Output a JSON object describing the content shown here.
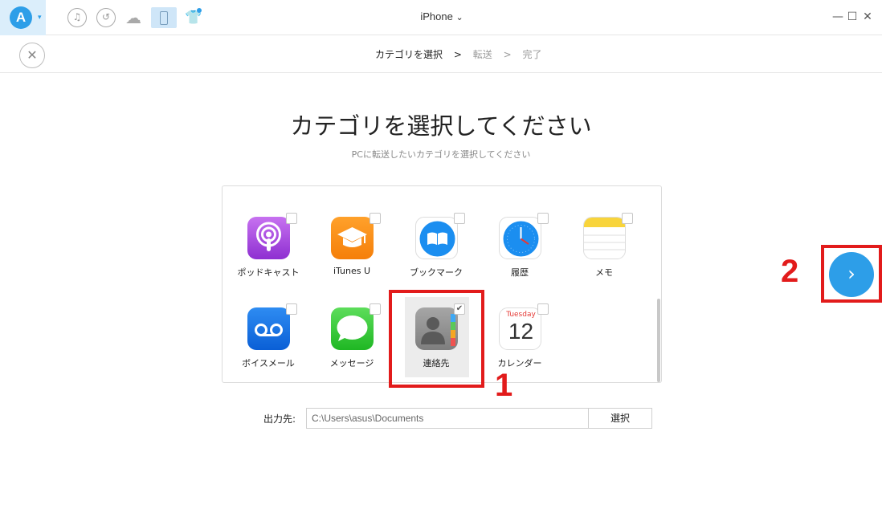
{
  "topbar": {
    "device_name": "iPhone",
    "device_caret": "⌄",
    "minimize": "—",
    "maximize": "☐",
    "close": "✕"
  },
  "stepbar": {
    "steps": [
      "カテゴリを選択",
      ">",
      "転送",
      ">",
      "完了"
    ]
  },
  "heading": {
    "title": "カテゴリを選択してください",
    "subtitle": "PCに転送したいカテゴリを選択してください"
  },
  "categories": [
    {
      "label": "ポッドキャスト",
      "checked": false,
      "icon": "podcast-icon"
    },
    {
      "label": "iTunes U",
      "checked": false,
      "icon": "itunes-u-icon"
    },
    {
      "label": "ブックマーク",
      "checked": false,
      "icon": "bookmark-icon"
    },
    {
      "label": "履歴",
      "checked": false,
      "icon": "history-icon"
    },
    {
      "label": "メモ",
      "checked": false,
      "icon": "notes-icon"
    },
    {
      "label": "ボイスメール",
      "checked": false,
      "icon": "voicemail-icon"
    },
    {
      "label": "メッセージ",
      "checked": false,
      "icon": "messages-icon"
    },
    {
      "label": "連絡先",
      "checked": true,
      "icon": "contacts-icon"
    },
    {
      "label": "カレンダー",
      "checked": false,
      "icon": "calendar-icon"
    }
  ],
  "calendar_icon": {
    "day_name": "Tuesday",
    "day_number": "12"
  },
  "output": {
    "label": "出力先:",
    "path": "C:\\Users\\asus\\Documents",
    "button_label": "選択"
  },
  "annotations": {
    "box1_number": "1",
    "box2_number": "2"
  },
  "colors": {
    "accent": "#2d9ee8",
    "annotation": "#e21b1b"
  }
}
